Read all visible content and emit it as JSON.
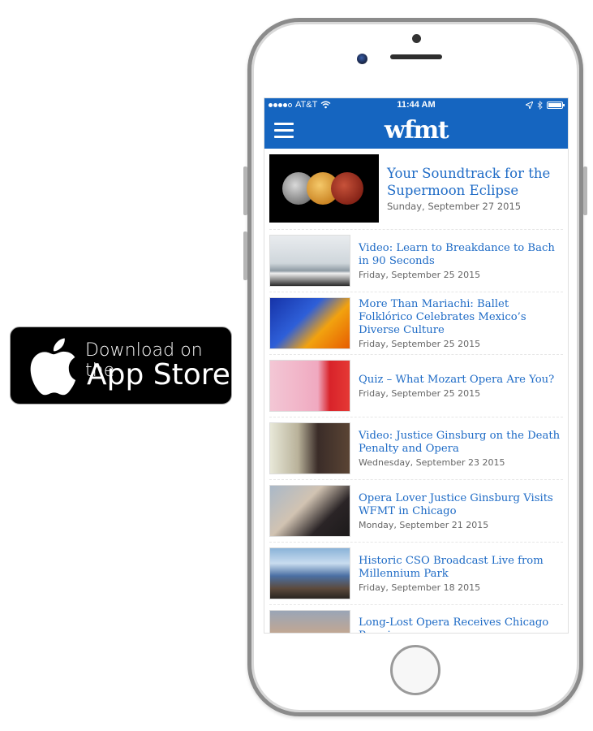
{
  "badge": {
    "line1": "Download on the",
    "line2": "App Store",
    "icon": "apple-logo-icon"
  },
  "status_bar": {
    "signal_bars_filled": 4,
    "signal_bars_total": 5,
    "carrier": "AT&T",
    "time": "11:44 AM",
    "icons": [
      "wifi-icon",
      "location-arrow-icon",
      "bluetooth-icon",
      "battery-icon"
    ],
    "battery_level": 1.0
  },
  "nav": {
    "logo": "wfmt",
    "menu_icon": "hamburger-menu-icon",
    "background_color": "#1565c0"
  },
  "feed": {
    "link_color": "#1e6bc6",
    "items": [
      {
        "title": "Your Soundtrack for the Supermoon Eclipse",
        "date": "Sunday, September 27 2015",
        "image": "supermoon-eclipse-image"
      },
      {
        "title": "Video: Learn to Breakdance to Bach in 90 Seconds",
        "date": "Friday, September 25 2015",
        "image": "breakdance-piano-hall-image"
      },
      {
        "title": "More Than Mariachi: Ballet Folklórico Celebrates Mexico’s Diverse Culture",
        "date": "Friday, September 25 2015",
        "image": "ballet-folklorico-dancers-image"
      },
      {
        "title": "Quiz – What Mozart Opera Are You?",
        "date": "Friday, September 25 2015",
        "image": "mozart-illustration-image"
      },
      {
        "title": "Video: Justice Ginsburg on the Death Penalty and Opera",
        "date": "Wednesday, September 23 2015",
        "image": "ginsburg-studio-image"
      },
      {
        "title": "Opera Lover Justice Ginsburg Visits WFMT in Chicago",
        "date": "Monday, September 21 2015",
        "image": "ginsburg-portrait-image"
      },
      {
        "title": "Historic CSO Broadcast Live from Millennium Park",
        "date": "Friday, September 18 2015",
        "image": "millennium-park-orchestra-image"
      },
      {
        "title": "Long-Lost Opera Receives Chicago Premiere",
        "date": "",
        "image": "opera-score-reader-image"
      }
    ]
  }
}
